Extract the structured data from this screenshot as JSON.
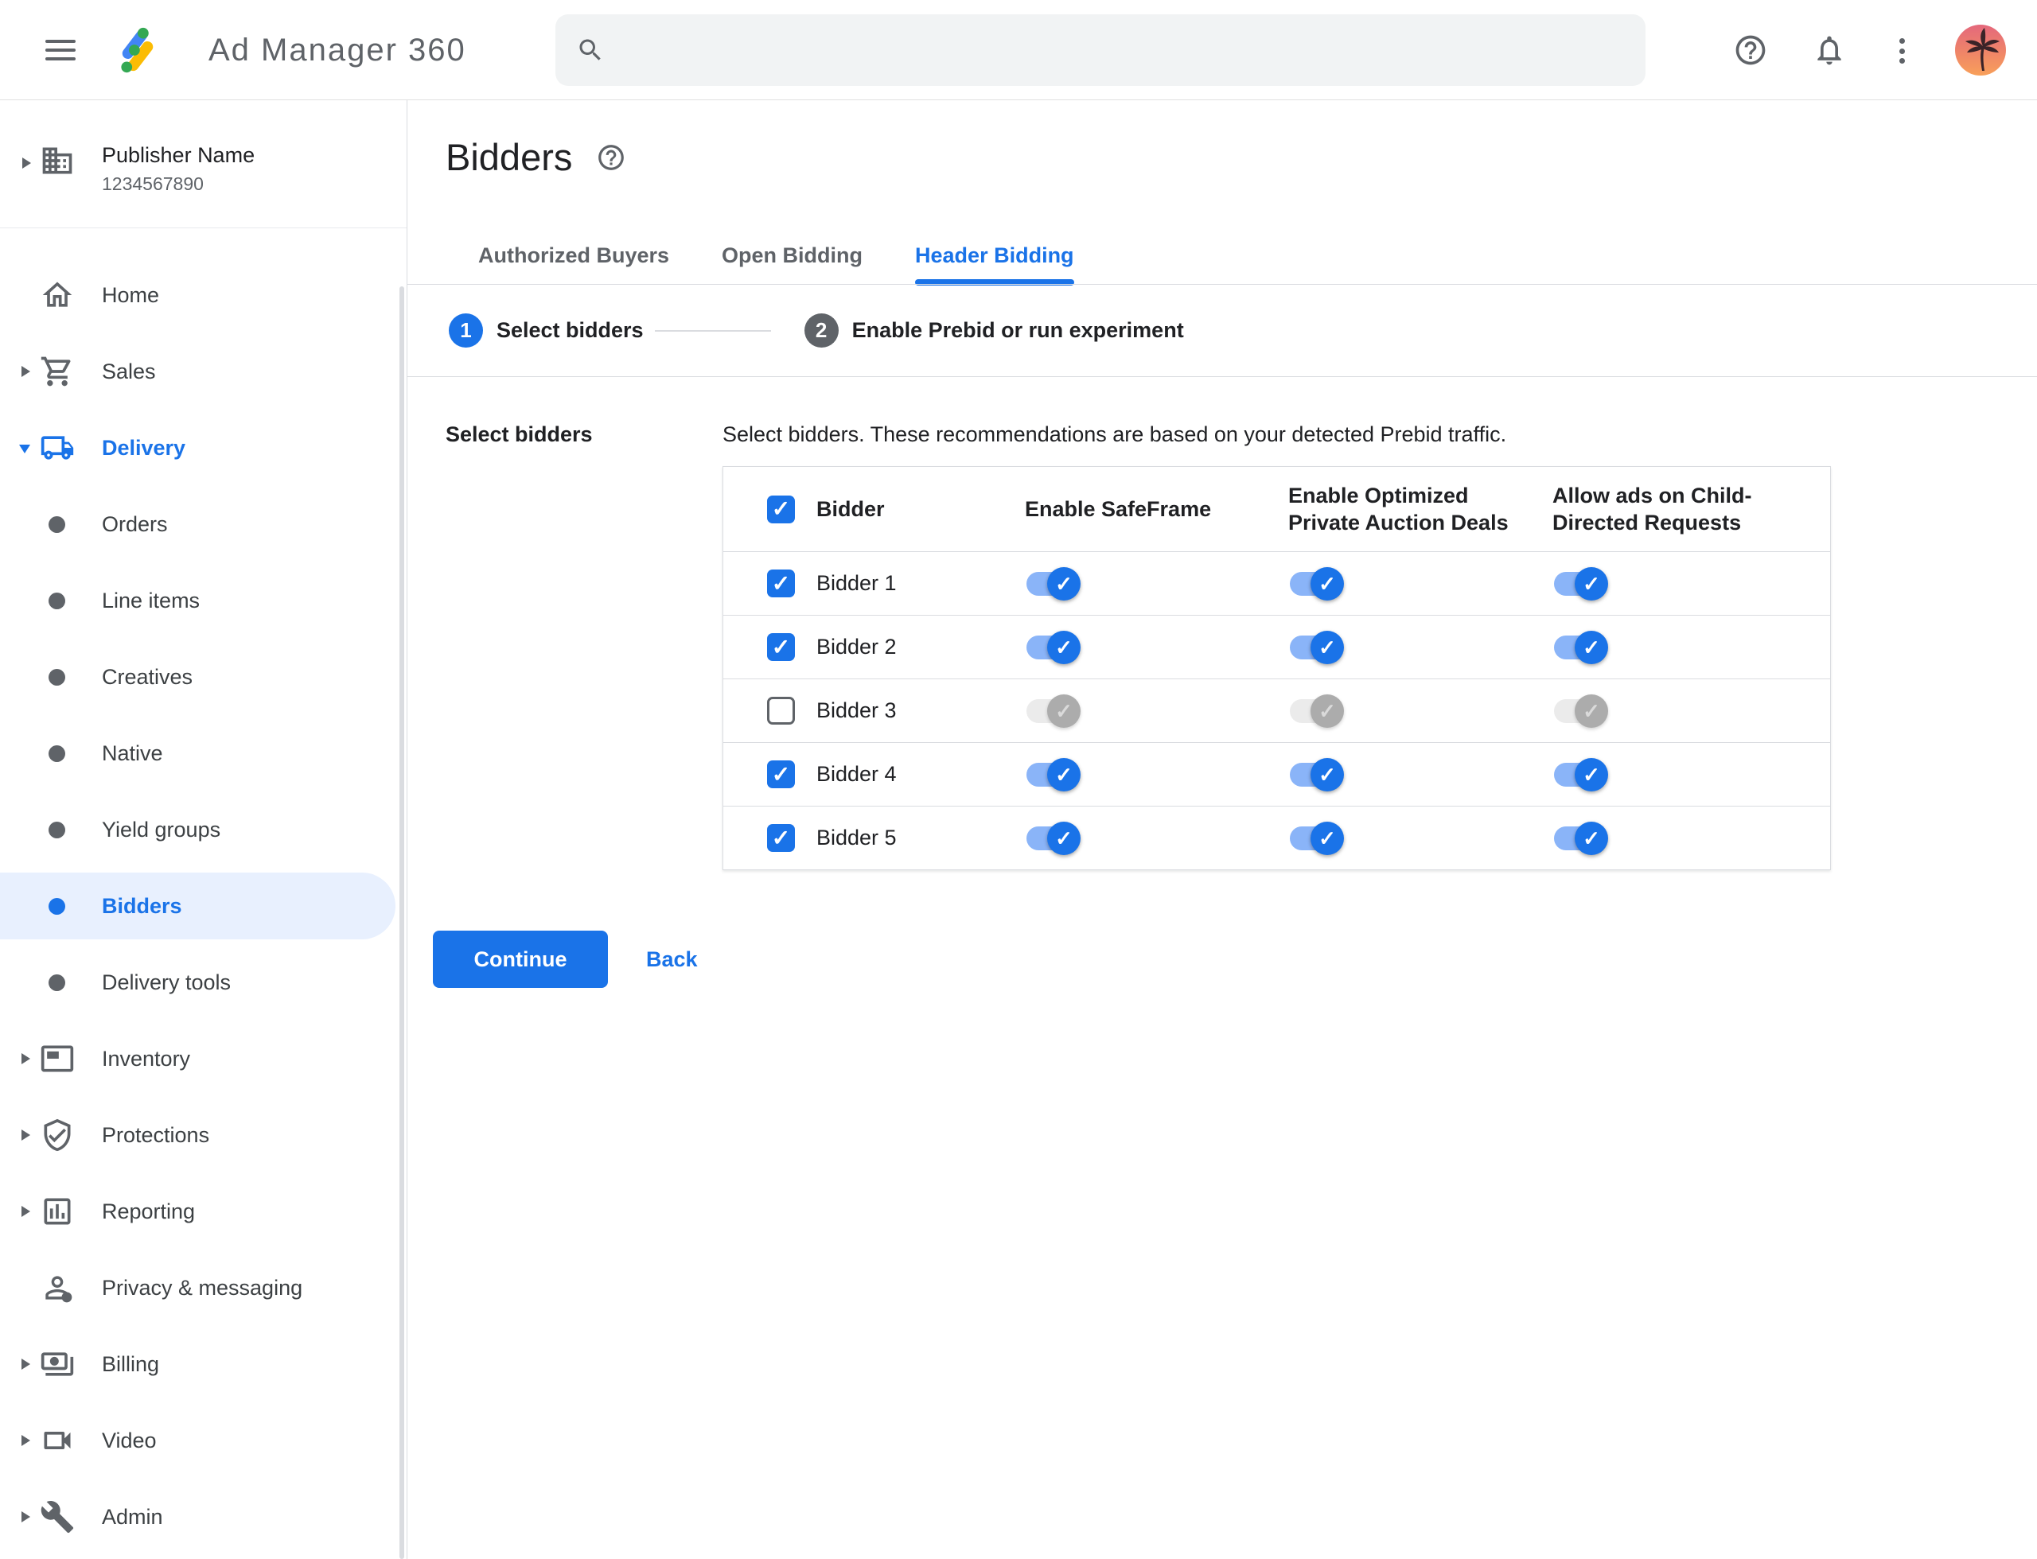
{
  "topbar": {
    "app_name": "Ad Manager 360",
    "search": {
      "placeholder": "",
      "value": ""
    },
    "icons": [
      "menu-icon",
      "search-icon",
      "help-icon",
      "bell-icon",
      "more-vert-icon",
      "avatar"
    ]
  },
  "sidebar": {
    "publisher": {
      "name": "Publisher Name",
      "id": "1234567890",
      "icon": "building-icon"
    },
    "items": [
      {
        "label": "Home",
        "icon": "home-icon",
        "arrow": "none",
        "state": "normal"
      },
      {
        "label": "Sales",
        "icon": "cart-icon",
        "arrow": "right",
        "state": "normal"
      },
      {
        "label": "Delivery",
        "icon": "truck-icon",
        "arrow": "down",
        "state": "expanded"
      },
      {
        "label": "Orders",
        "icon": "bullet",
        "arrow": "none",
        "state": "normal"
      },
      {
        "label": "Line items",
        "icon": "bullet",
        "arrow": "none",
        "state": "normal"
      },
      {
        "label": "Creatives",
        "icon": "bullet",
        "arrow": "none",
        "state": "normal"
      },
      {
        "label": "Native",
        "icon": "bullet",
        "arrow": "none",
        "state": "normal"
      },
      {
        "label": "Yield groups",
        "icon": "bullet",
        "arrow": "none",
        "state": "normal"
      },
      {
        "label": "Bidders",
        "icon": "bullet",
        "arrow": "none",
        "state": "selected"
      },
      {
        "label": "Delivery tools",
        "icon": "bullet",
        "arrow": "none",
        "state": "normal"
      },
      {
        "label": "Inventory",
        "icon": "inventory-icon",
        "arrow": "right",
        "state": "normal"
      },
      {
        "label": "Protections",
        "icon": "shield-check-icon",
        "arrow": "right",
        "state": "normal"
      },
      {
        "label": "Reporting",
        "icon": "bar-chart-icon",
        "arrow": "right",
        "state": "normal"
      },
      {
        "label": "Privacy & messaging",
        "icon": "person-shield-icon",
        "arrow": "none",
        "state": "normal"
      },
      {
        "label": "Billing",
        "icon": "payments-icon",
        "arrow": "right",
        "state": "normal"
      },
      {
        "label": "Video",
        "icon": "videocam-icon",
        "arrow": "right",
        "state": "normal"
      },
      {
        "label": "Admin",
        "icon": "wrench-icon",
        "arrow": "right",
        "state": "normal"
      }
    ]
  },
  "main": {
    "title": "Bidders",
    "title_help_icon": "help-icon",
    "tabs": [
      {
        "label": "Authorized Buyers",
        "state": "inactive"
      },
      {
        "label": "Open Bidding",
        "state": "inactive"
      },
      {
        "label": "Header Bidding",
        "state": "active"
      }
    ],
    "stepper": [
      {
        "number": "1",
        "label": "Select bidders",
        "state": "active"
      },
      {
        "number": "2",
        "label": "Enable Prebid or run experiment",
        "state": "upcoming"
      }
    ],
    "section": {
      "label": "Select bidders",
      "description": "Select bidders. These recommendations are based on your detected Prebid traffic.",
      "table": {
        "header_checkbox": "checked",
        "columns": [
          "Bidder",
          "Enable SafeFrame",
          "Enable Optimized Private Auction Deals",
          "Allow ads on Child-Directed Requests"
        ],
        "rows": [
          {
            "name": "Bidder 1",
            "checkbox": "checked",
            "toggles": [
              "on",
              "on",
              "on"
            ]
          },
          {
            "name": "Bidder 2",
            "checkbox": "checked",
            "toggles": [
              "on",
              "on",
              "on"
            ]
          },
          {
            "name": "Bidder 3",
            "checkbox": "unchecked",
            "toggles": [
              "disabled",
              "disabled",
              "disabled"
            ]
          },
          {
            "name": "Bidder 4",
            "checkbox": "checked",
            "toggles": [
              "on",
              "on",
              "on"
            ]
          },
          {
            "name": "Bidder 5",
            "checkbox": "checked",
            "toggles": [
              "on",
              "on",
              "on"
            ]
          }
        ]
      },
      "actions": {
        "continue": "Continue",
        "back": "Back"
      }
    }
  },
  "colors": {
    "accent": "#1a73e8",
    "toggle_track_on": "#8ab4f8",
    "toggle_thumb_on": "#1a73e8",
    "toggle_track_off": "#ebebeb",
    "toggle_thumb_off": "#acacac",
    "selected_item_bg": "#e8f0fe",
    "divider": "#dadce0",
    "text_primary": "#202124",
    "text_secondary": "#5f6368",
    "search_bg": "#f1f3f4",
    "logo_blue": "#4285f4",
    "logo_yellow": "#fbbc04",
    "logo_green": "#34a853"
  }
}
